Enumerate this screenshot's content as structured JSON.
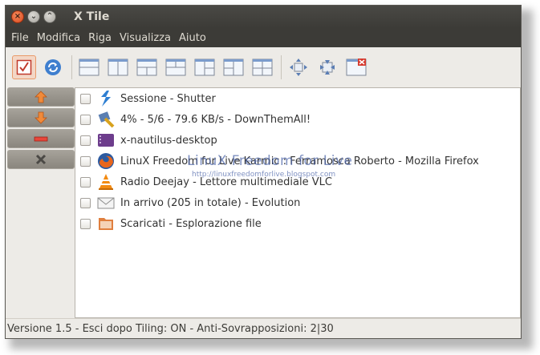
{
  "window": {
    "title": "X Tile"
  },
  "menu": [
    "File",
    "Modifica",
    "Riga",
    "Visualizza",
    "Aiuto"
  ],
  "toolbar": {
    "icons": [
      "checkbox-icon",
      "refresh-icon",
      "tile-horizontal-icon",
      "tile-vertical-icon",
      "tile-triangle-up-icon",
      "tile-triangle-down-icon",
      "tile-triangle-left-icon",
      "tile-triangle-right-icon",
      "tile-grid-icon",
      "maximize-icon",
      "unmaximize-icon",
      "close-windows-icon"
    ]
  },
  "sidebar": {
    "buttons": [
      "arrow-up-icon",
      "arrow-down-icon",
      "minus-icon",
      "close-icon"
    ]
  },
  "windows": [
    {
      "label": "Sessione - Shutter",
      "icon": "shutter-icon"
    },
    {
      "label": "4% - 5/6 - 79.6 KB/s - DownThemAll!",
      "icon": "downthemall-icon"
    },
    {
      "label": "x-nautilus-desktop",
      "icon": "nautilus-desktop-icon"
    },
    {
      "label": "LinuX Freedom for Live Karmic : Ferramosca Roberto - Mozilla Firefox",
      "icon": "firefox-icon"
    },
    {
      "label": "Radio Deejay - Lettore multimediale VLC",
      "icon": "vlc-icon"
    },
    {
      "label": "In arrivo (205 in totale) - Evolution",
      "icon": "mail-icon"
    },
    {
      "label": "Scaricati - Esplorazione file",
      "icon": "folder-icon"
    }
  ],
  "watermark": {
    "title": "LinuX Freedom for Live",
    "url": "http://linuxfreedomforlive.blogspot.com"
  },
  "status": {
    "text": "Versione 1.5  -  Esci dopo Tiling: ON  -  Anti-Sovrapposizioni: 2|30"
  },
  "colors": {
    "titlebar": "#3c3b37",
    "accent": "#e06a2c",
    "close_button": "#d9481d"
  }
}
